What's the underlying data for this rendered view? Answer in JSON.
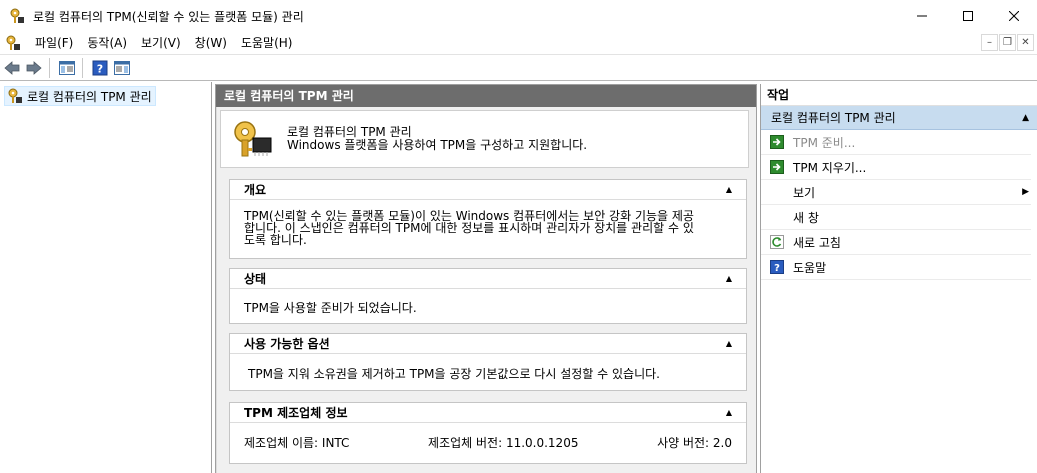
{
  "window": {
    "title": "로컬 컴퓨터의 TPM(신뢰할 수 있는 플랫폼 모듈) 관리"
  },
  "menu": {
    "items": [
      "파일(F)",
      "동작(A)",
      "보기(V)",
      "창(W)",
      "도움말(H)"
    ]
  },
  "tree": {
    "root_label": "로컬 컴퓨터의 TPM 관리"
  },
  "center": {
    "header": "로컬 컴퓨터의 TPM 관리",
    "intro_title": "로컬 컴퓨터의 TPM 관리",
    "intro_subtitle": "Windows 플랫폼을 사용하여 TPM을 구성하고 지원합니다.",
    "sections": {
      "overview": {
        "title": "개요",
        "lines": [
          "TPM(신뢰할 수 있는 플랫폼 모듈)이 있는 Windows 컴퓨터에서는 보안 강화 기능을 제공",
          "합니다. 이 스냅인은 컴퓨터의 TPM에 대한 정보를 표시하며 관리자가 장치를 관리할 수 있",
          "도록 합니다."
        ]
      },
      "status": {
        "title": "상태",
        "text": "TPM을 사용할 준비가 되었습니다."
      },
      "options": {
        "title": "사용 가능한 옵션",
        "text": "TPM을 지워 소유권을 제거하고 TPM을 공장 기본값으로 다시 설정할 수 있습니다."
      },
      "manufacturer": {
        "title": "TPM 제조업체 정보",
        "name": "제조업체 이름: INTC",
        "version": "제조업체 버전: 11.0.0.1205",
        "spec": "사양 버전: 2.0"
      }
    }
  },
  "actions": {
    "header": "작업",
    "group_label": "로컬 컴퓨터의 TPM 관리",
    "items": [
      {
        "label": "TPM 준비...",
        "icon": "green-arrow-icon",
        "disabled": true
      },
      {
        "label": "TPM 지우기...",
        "icon": "green-arrow-icon",
        "disabled": false
      },
      {
        "label": "보기",
        "icon": "",
        "disabled": false,
        "submenu": true
      },
      {
        "label": "새 창",
        "icon": "",
        "disabled": false
      },
      {
        "label": "새로 고침",
        "icon": "refresh-icon",
        "disabled": false
      },
      {
        "label": "도움말",
        "icon": "help-icon",
        "disabled": false
      }
    ]
  },
  "colors": {
    "center_header_bg": "#6d6d6d",
    "actions_group_bg": "#c7dcef",
    "green_icon": "#2e8b2e"
  }
}
